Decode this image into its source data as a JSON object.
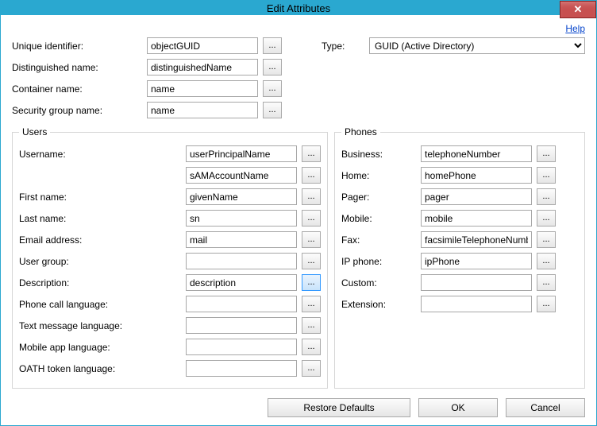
{
  "window": {
    "title": "Edit Attributes"
  },
  "help": {
    "label": "Help"
  },
  "top": {
    "unique_identifier": {
      "label": "Unique identifier:",
      "value": "objectGUID"
    },
    "type": {
      "label": "Type:",
      "selected": "GUID (Active Directory)"
    },
    "distinguished_name": {
      "label": "Distinguished name:",
      "value": "distinguishedName"
    },
    "container_name": {
      "label": "Container name:",
      "value": "name"
    },
    "security_group_name": {
      "label": "Security group name:",
      "value": "name"
    }
  },
  "users": {
    "legend": "Users",
    "username": {
      "label": "Username:",
      "value": "userPrincipalName"
    },
    "username2": {
      "value": "sAMAccountName"
    },
    "first_name": {
      "label": "First name:",
      "value": "givenName"
    },
    "last_name": {
      "label": "Last name:",
      "value": "sn"
    },
    "email": {
      "label": "Email address:",
      "value": "mail"
    },
    "user_group": {
      "label": "User group:",
      "value": ""
    },
    "description": {
      "label": "Description:",
      "value": "description"
    },
    "phone_call_lang": {
      "label": "Phone call language:",
      "value": ""
    },
    "text_msg_lang": {
      "label": "Text message language:",
      "value": ""
    },
    "mobile_app_lang": {
      "label": "Mobile app language:",
      "value": ""
    },
    "oath_token_lang": {
      "label": "OATH token language:",
      "value": ""
    }
  },
  "phones": {
    "legend": "Phones",
    "business": {
      "label": "Business:",
      "value": "telephoneNumber"
    },
    "home": {
      "label": "Home:",
      "value": "homePhone"
    },
    "pager": {
      "label": "Pager:",
      "value": "pager"
    },
    "mobile": {
      "label": "Mobile:",
      "value": "mobile"
    },
    "fax": {
      "label": "Fax:",
      "value": "facsimileTelephoneNumber"
    },
    "ip_phone": {
      "label": "IP phone:",
      "value": "ipPhone"
    },
    "custom": {
      "label": "Custom:",
      "value": ""
    },
    "extension": {
      "label": "Extension:",
      "value": ""
    }
  },
  "buttons": {
    "restore": "Restore Defaults",
    "ok": "OK",
    "cancel": "Cancel"
  }
}
